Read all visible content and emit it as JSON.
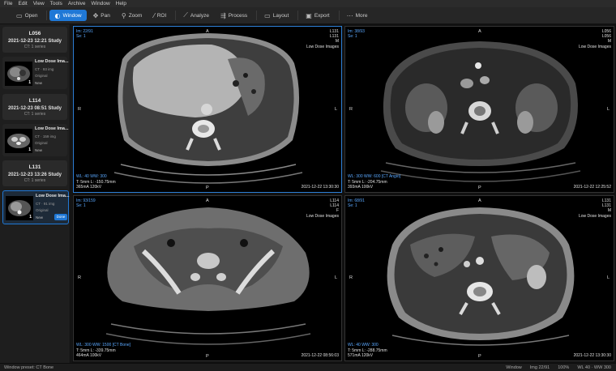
{
  "menu": [
    "File",
    "Edit",
    "View",
    "Tools",
    "Archive",
    "Window",
    "Help"
  ],
  "toolbar": {
    "open": "Open",
    "window": "Window",
    "pan": "Pan",
    "zoom": "Zoom",
    "roi": "ROI",
    "analyze": "Analyze",
    "process": "Process",
    "layout": "Layout",
    "export": "Export",
    "more": "More"
  },
  "sidebar": {
    "studies": [
      {
        "id": "L056",
        "date": "2021-12-23 12:21  Study",
        "count": "CT: 1 series",
        "series": {
          "name": "Low Dose Ima...",
          "info": "CT · 93 img",
          "original": "Original",
          "new": "New",
          "num": "1"
        }
      },
      {
        "id": "L114",
        "date": "2021-12-23 08:51  Study",
        "count": "CT: 1 series",
        "series": {
          "name": "Low Dose Ima...",
          "info": "CT · 159 img",
          "original": "Original",
          "new": "New",
          "num": "1"
        }
      },
      {
        "id": "L131",
        "date": "2021-12-23 13:26  Study",
        "count": "CT: 1 series",
        "series": {
          "name": "Low Dose Ima...",
          "info": "CT · 91 img",
          "original": "Original",
          "new": "New",
          "done": "Done",
          "num": "1"
        }
      }
    ]
  },
  "viewports": [
    {
      "tl1": "Im: 22/91",
      "tl2": "Se: 1",
      "tr1": "L131",
      "tr2": "L131",
      "tr3": "M",
      "tr4": "Low Dose Images",
      "bl1": "WL: 40 WW: 300",
      "bl2": "T: 5mm L: -150.75mm",
      "bl3": "365mA 120kV",
      "br1": "2021-12-22 13:30:30",
      "top": "A",
      "bottom": "P",
      "left": "R",
      "right": "L"
    },
    {
      "tl1": "Im: 38/93",
      "tl2": "Se: 1",
      "tr1": "L056",
      "tr2": "L056",
      "tr3": "M",
      "tr4": "Low Dose Images",
      "bl1": "WL: 300 WW: 600 [CT Angio]",
      "bl2": "T: 5mm L: -204.75mm",
      "bl3": "393mA 100kV",
      "br1": "2021-12-22 12:25:52",
      "top": "A",
      "bottom": "P",
      "left": "R",
      "right": "L"
    },
    {
      "tl1": "Im: 93/159",
      "tl2": "Se: 1",
      "tr1": "L114",
      "tr2": "L114",
      "tr3": "F",
      "tr4": "Low Dose Images",
      "bl1": "WL: 300 WW: 1500 [CT Bone]",
      "bl2": "T: 5mm L: -339.75mm",
      "bl3": "464mA 100kV",
      "br1": "2021-12-22 08:56:03",
      "top": "A",
      "bottom": "P",
      "left": "R",
      "right": "L"
    },
    {
      "tl1": "Im: 68/91",
      "tl2": "Se: 1",
      "tr1": "L131",
      "tr2": "L131",
      "tr3": "M",
      "tr4": "Low Dose Images",
      "bl1": "WL: 40 WW: 300",
      "bl2": "T: 5mm L: -288.75mm",
      "bl3": "571mA 120kV",
      "br1": "2021-12-22 13:30:30",
      "top": "A",
      "bottom": "P",
      "left": "R",
      "right": "L"
    }
  ],
  "status": {
    "preset": "Window preset: CT Bone",
    "tool": "Window",
    "img": "Img 22/91",
    "zoom": "100%",
    "wlww": "WL 40 · WW 300"
  },
  "colors": {
    "accent": "#1f78d6",
    "overlay_blue": "#5aa8ff"
  }
}
